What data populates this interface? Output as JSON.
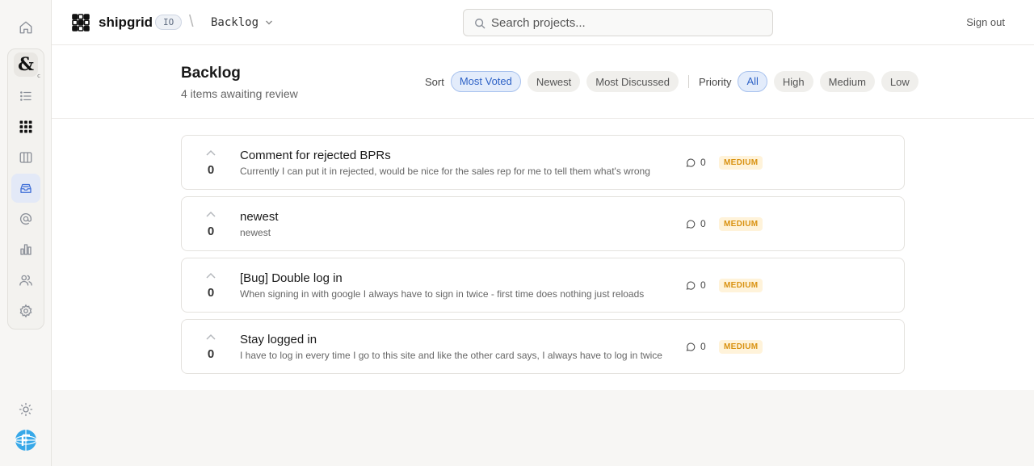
{
  "header": {
    "brand": "shipgrid",
    "badge": "IO",
    "breadcrumb": "Backlog",
    "search_placeholder": "Search projects...",
    "sign_out": "Sign out"
  },
  "page": {
    "title": "Backlog",
    "subtitle": "4 items awaiting review"
  },
  "filters": {
    "sort_label": "Sort",
    "sort_options": [
      "Most Voted",
      "Newest",
      "Most Discussed"
    ],
    "sort_selected": "Most Voted",
    "priority_label": "Priority",
    "priority_options": [
      "All",
      "High",
      "Medium",
      "Low"
    ],
    "priority_selected": "All"
  },
  "items": [
    {
      "votes": "0",
      "title": "Comment for rejected BPRs",
      "description": "Currently I can put it in rejected, would be nice for the sales rep for me to tell them what's wrong",
      "comments": "0",
      "priority": "MEDIUM"
    },
    {
      "votes": "0",
      "title": "newest",
      "description": "newest",
      "comments": "0",
      "priority": "MEDIUM"
    },
    {
      "votes": "0",
      "title": "[Bug] Double log in",
      "description": "When signing in with google I always have to sign in twice - first time does nothing just reloads",
      "comments": "0",
      "priority": "MEDIUM"
    },
    {
      "votes": "0",
      "title": "Stay logged in",
      "description": "I have to log in every time I go to this site and like the other card says, I always have to log in twice",
      "comments": "0",
      "priority": "MEDIUM"
    }
  ],
  "rail": {
    "app_glyph": "&",
    "app_sub": "c",
    "icons": [
      "home-icon",
      "app-avatar",
      "list-icon",
      "grid-icon",
      "columns-icon",
      "inbox-icon",
      "at-icon",
      "chart-icon",
      "users-icon",
      "gear-icon",
      "sun-icon",
      "globe-logo"
    ]
  },
  "colors": {
    "accent": "#3f6fd8",
    "medium_priority_bg": "#fff3da",
    "medium_priority_text": "#d99212"
  }
}
